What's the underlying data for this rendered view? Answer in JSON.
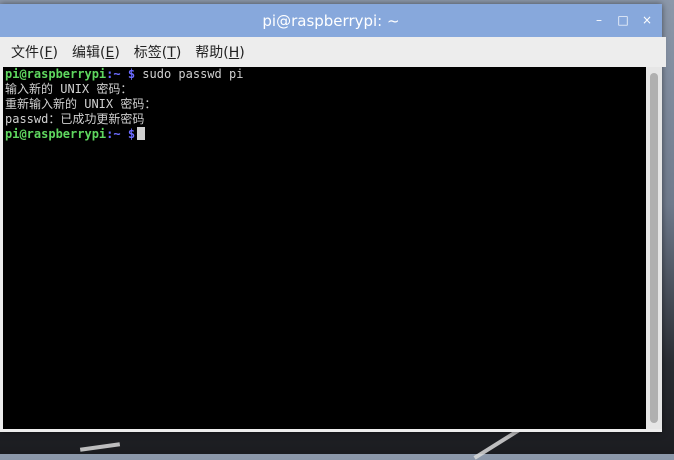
{
  "window": {
    "title": "pi@raspberrypi: ~",
    "controls": {
      "minimize": "–",
      "maximize": "□",
      "close": "×"
    }
  },
  "menubar": {
    "items": [
      {
        "label": "文件(",
        "accel": "F",
        "suffix": ")"
      },
      {
        "label": "编辑(",
        "accel": "E",
        "suffix": ")"
      },
      {
        "label": "标签(",
        "accel": "T",
        "suffix": ")"
      },
      {
        "label": "帮助(",
        "accel": "H",
        "suffix": ")"
      }
    ]
  },
  "terminal": {
    "prompt_user": "pi@raspberrypi",
    "prompt_path": ":~",
    "prompt_sign": " $",
    "command1": " sudo passwd pi",
    "line2": "输入新的 UNIX 密码：",
    "line3": "重新输入新的 UNIX 密码：",
    "line4": "passwd：已成功更新密码"
  },
  "colors": {
    "titlebar": "#87a8dc",
    "terminal_bg": "#000000",
    "prompt_user": "#5fd75f",
    "prompt_path": "#6c6cff"
  }
}
